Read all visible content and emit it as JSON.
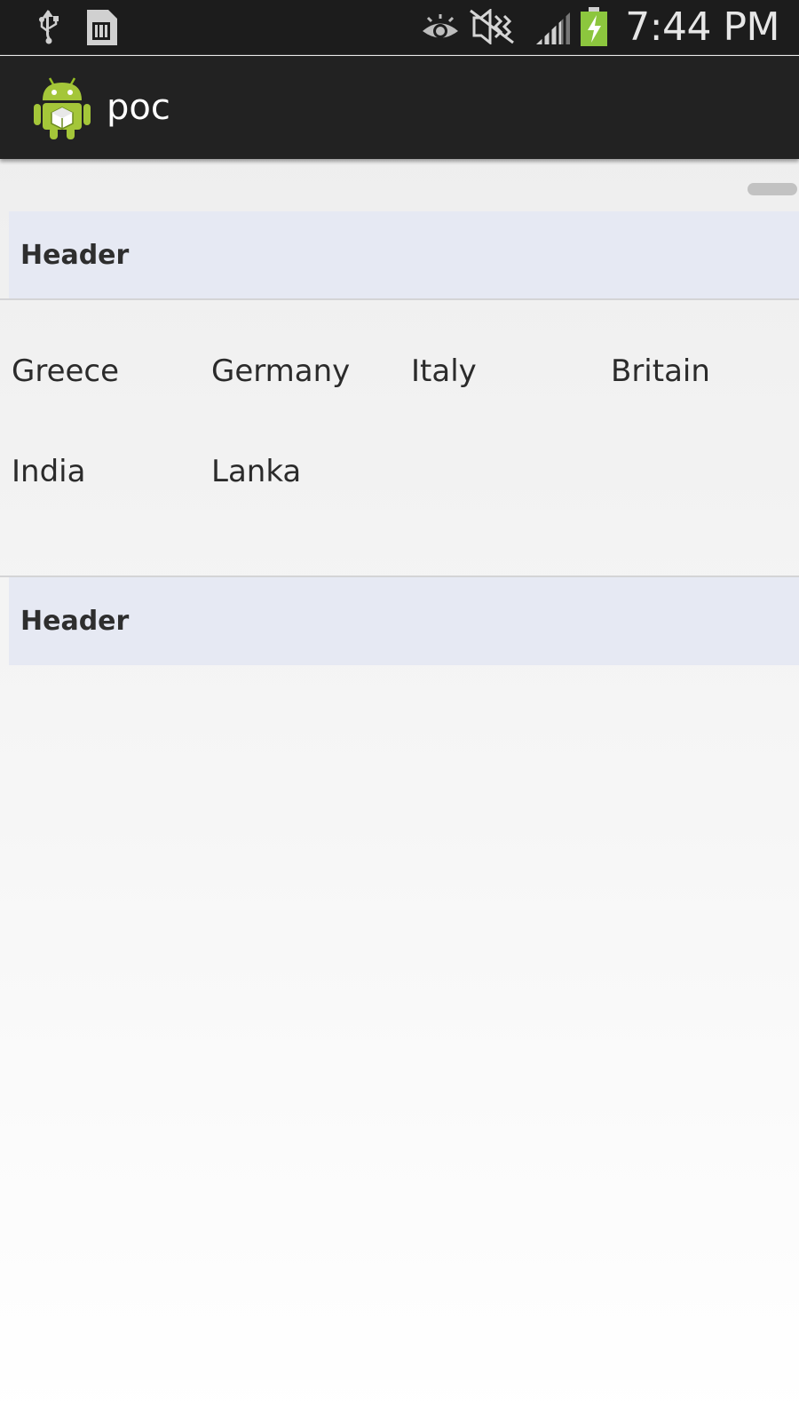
{
  "status_bar": {
    "time": "7:44 PM",
    "icons": [
      "usb-icon",
      "sim-card-icon",
      "eye-icon",
      "mute-icon",
      "signal-icon",
      "battery-charging-icon"
    ]
  },
  "action_bar": {
    "title": "poc",
    "icon": "android-app-icon"
  },
  "sections": [
    {
      "header": "Header",
      "items": [
        "Greece",
        "Germany",
        "Italy",
        "Britain",
        "India",
        "Lanka"
      ]
    },
    {
      "header": "Header",
      "items": []
    }
  ],
  "colors": {
    "status_bar_bg": "#1c1c1c",
    "action_bar_bg": "#222222",
    "header_bg": "#e6e9f3",
    "battery_green": "#8cc63e"
  }
}
